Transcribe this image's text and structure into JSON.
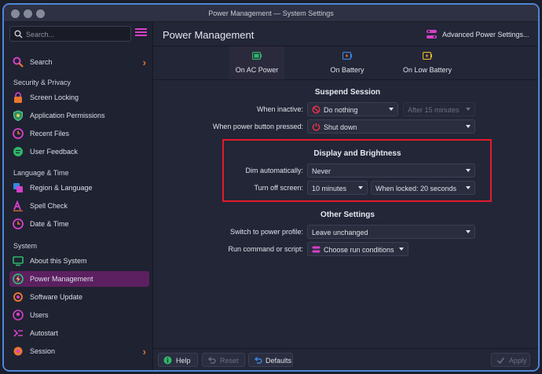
{
  "window": {
    "title": "Power Management — System Settings"
  },
  "search": {
    "placeholder": "Search..."
  },
  "sidebar": {
    "top_item": {
      "label": "Search"
    },
    "sections": [
      {
        "header": "Security & Privacy",
        "items": [
          {
            "label": "Screen Locking"
          },
          {
            "label": "Application Permissions"
          },
          {
            "label": "Recent Files"
          },
          {
            "label": "User Feedback"
          }
        ]
      },
      {
        "header": "Language & Time",
        "items": [
          {
            "label": "Region & Language"
          },
          {
            "label": "Spell Check"
          },
          {
            "label": "Date & Time"
          }
        ]
      },
      {
        "header": "System",
        "items": [
          {
            "label": "About this System"
          },
          {
            "label": "Power Management"
          },
          {
            "label": "Software Update"
          },
          {
            "label": "Users"
          },
          {
            "label": "Autostart"
          },
          {
            "label": "Session"
          }
        ]
      }
    ]
  },
  "header": {
    "title": "Power Management",
    "advanced_label": "Advanced Power Settings..."
  },
  "tabs": [
    {
      "label": "On AC Power"
    },
    {
      "label": "On Battery"
    },
    {
      "label": "On Low Battery"
    }
  ],
  "suspend": {
    "title": "Suspend Session",
    "inactive_label": "When inactive:",
    "inactive_value": "Do nothing",
    "inactive_after": "After 15 minutes",
    "power_button_label": "When power button pressed:",
    "power_button_value": "Shut down"
  },
  "display": {
    "title": "Display and Brightness",
    "dim_label": "Dim automatically:",
    "dim_value": "Never",
    "off_label": "Turn off screen:",
    "off_value": "10 minutes",
    "off_locked_value": "When locked: 20 seconds"
  },
  "other": {
    "title": "Other Settings",
    "profile_label": "Switch to power profile:",
    "profile_value": "Leave unchanged",
    "run_label": "Run command or script:",
    "run_value": "Choose run conditions"
  },
  "footer": {
    "help": "Help",
    "reset": "Reset",
    "defaults": "Defaults",
    "apply": "Apply"
  },
  "colors": {
    "accent": "#d640c8",
    "highlight": "#e01b2a",
    "active_item": "#5c2060"
  }
}
